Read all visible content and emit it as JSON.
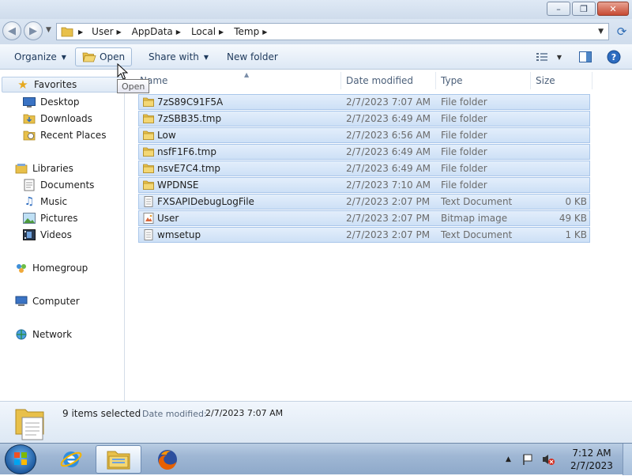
{
  "window": {
    "caption_buttons": {
      "minimize": "–",
      "maximize": "❐",
      "close": "✕"
    }
  },
  "address": {
    "breadcrumbs": [
      "User",
      "AppData",
      "Local",
      "Temp"
    ]
  },
  "toolbar": {
    "organize": "Organize",
    "open": "Open",
    "share_with": "Share with",
    "new_folder": "New folder"
  },
  "tooltip": "Open",
  "nav": {
    "favorites": "Favorites",
    "desktop": "Desktop",
    "downloads": "Downloads",
    "recent_places": "Recent Places",
    "libraries": "Libraries",
    "documents": "Documents",
    "music": "Music",
    "pictures": "Pictures",
    "videos": "Videos",
    "homegroup": "Homegroup",
    "computer": "Computer",
    "network": "Network"
  },
  "columns": {
    "name": "Name",
    "date_modified": "Date modified",
    "type": "Type",
    "size": "Size"
  },
  "files": [
    {
      "name": "7zS89C91F5A",
      "date": "2/7/2023 7:07 AM",
      "type": "File folder",
      "size": "",
      "icon": "folder-icon"
    },
    {
      "name": "7zSBB35.tmp",
      "date": "2/7/2023 6:49 AM",
      "type": "File folder",
      "size": "",
      "icon": "folder-icon"
    },
    {
      "name": "Low",
      "date": "2/7/2023 6:56 AM",
      "type": "File folder",
      "size": "",
      "icon": "folder-icon"
    },
    {
      "name": "nsfF1F6.tmp",
      "date": "2/7/2023 6:49 AM",
      "type": "File folder",
      "size": "",
      "icon": "folder-icon"
    },
    {
      "name": "nsvE7C4.tmp",
      "date": "2/7/2023 6:49 AM",
      "type": "File folder",
      "size": "",
      "icon": "folder-icon"
    },
    {
      "name": "WPDNSE",
      "date": "2/7/2023 7:10 AM",
      "type": "File folder",
      "size": "",
      "icon": "folder-icon"
    },
    {
      "name": "FXSAPIDebugLogFile",
      "date": "2/7/2023 2:07 PM",
      "type": "Text Document",
      "size": "0 KB",
      "icon": "text-file-icon"
    },
    {
      "name": "User",
      "date": "2/7/2023 2:07 PM",
      "type": "Bitmap image",
      "size": "49 KB",
      "icon": "bitmap-file-icon"
    },
    {
      "name": "wmsetup",
      "date": "2/7/2023 2:07 PM",
      "type": "Text Document",
      "size": "1 KB",
      "icon": "text-file-icon"
    }
  ],
  "details": {
    "count": "9 items selected",
    "label": "Date modified:",
    "value": "2/7/2023 7:07 AM"
  },
  "clock": {
    "time": "7:12 AM",
    "date": "2/7/2023"
  },
  "colors": {
    "selection": "#cde0f6",
    "selection_border": "#a9c6ea",
    "link_blue": "#1e395b"
  }
}
